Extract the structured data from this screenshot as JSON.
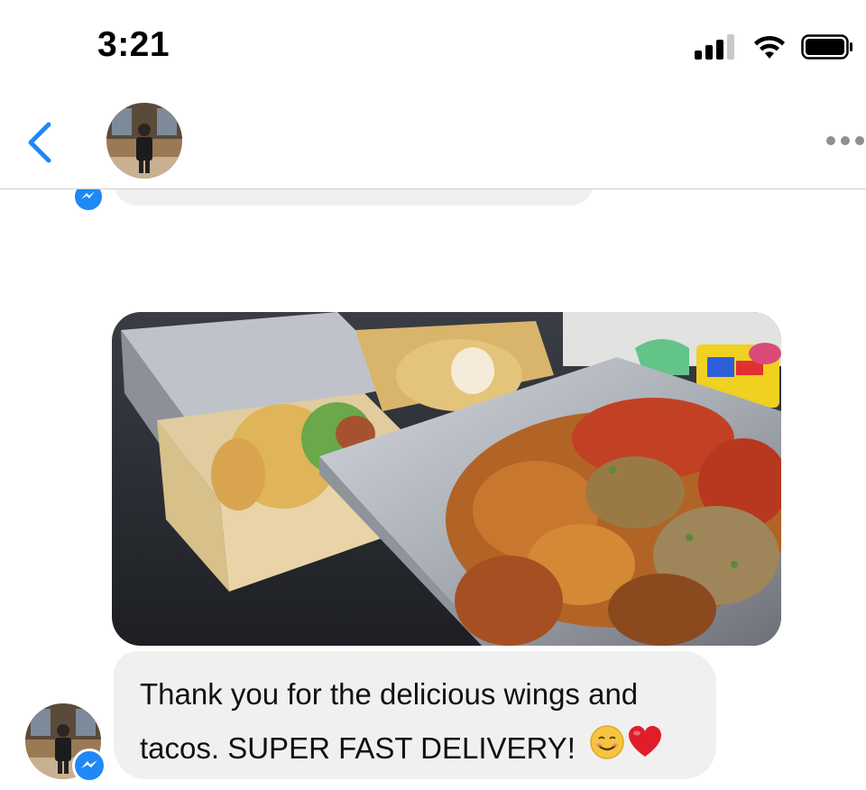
{
  "status_bar": {
    "time": "3:21",
    "icons": [
      "cellular-signal-icon",
      "wifi-icon",
      "battery-icon"
    ]
  },
  "header": {
    "back_icon": "chevron-left-icon",
    "avatar": "contact-avatar",
    "more_icon": "more-options-icon"
  },
  "conversation": {
    "photo_message": {
      "description_icon": "food-photo"
    },
    "text_message": {
      "line1": "Thank you for the delicious wings and",
      "line2": "tacos. SUPER FAST DELIVERY!",
      "emojis": [
        "😊",
        "❤️"
      ]
    }
  },
  "colors": {
    "accent": "#1f88f5",
    "bubble": "#f0f0f0",
    "divider": "#cfcfcf"
  }
}
